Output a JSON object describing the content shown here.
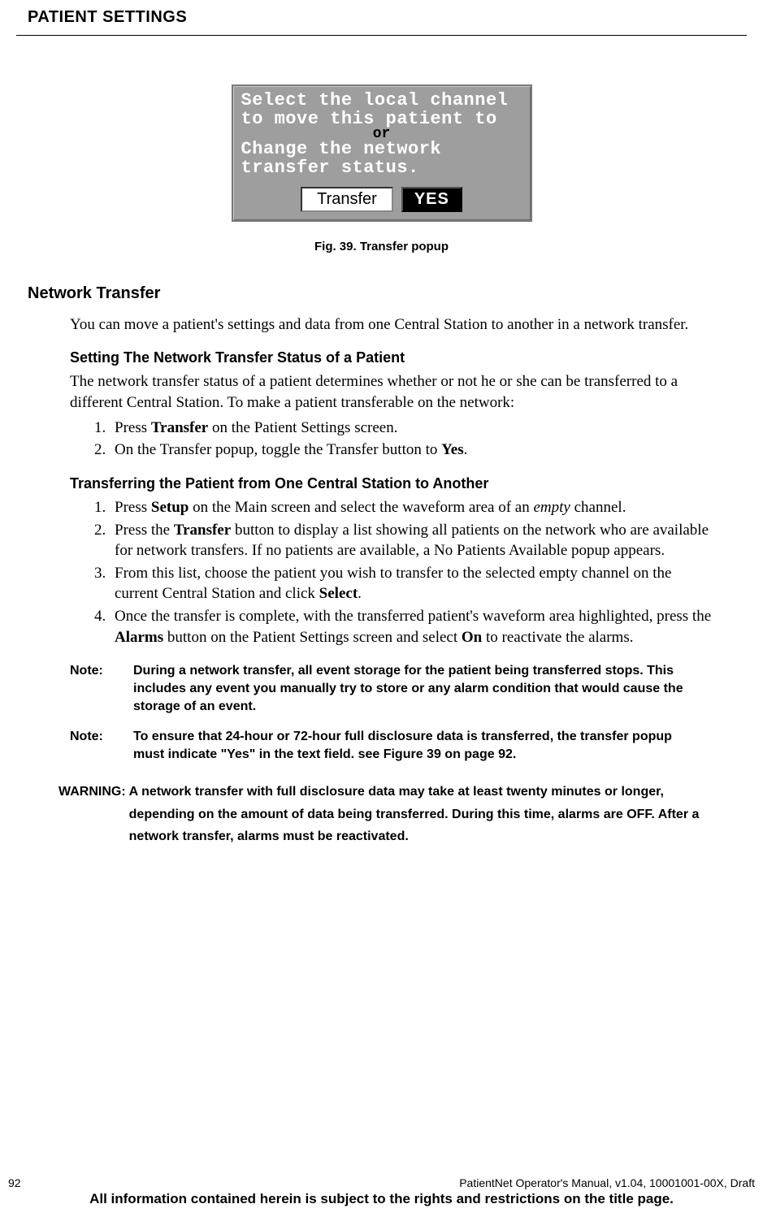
{
  "header": {
    "title": "PATIENT SETTINGS"
  },
  "figure": {
    "popup_line1": "Select the local channel",
    "popup_line2": "to move this patient to",
    "popup_or": "or",
    "popup_line3": "Change the network",
    "popup_line4": "transfer status.",
    "btn_transfer": "Transfer",
    "btn_yes": "YES",
    "caption": "Fig. 39. Transfer popup"
  },
  "section": {
    "h2": "Network Transfer",
    "intro": "You can move a patient's settings and data from one Central Station to another in a network transfer.",
    "sub1": {
      "title": "Setting The Network Transfer Status of a Patient",
      "para": "The network transfer status of a patient determines whether or not he or she can be transferred to a different Central Station. To make a patient transferable on the network:",
      "step1_a": "Press ",
      "step1_b": "Transfer",
      "step1_c": " on the Patient Settings screen.",
      "step2_a": "On the Transfer popup, toggle the Transfer button to ",
      "step2_b": "Yes",
      "step2_c": "."
    },
    "sub2": {
      "title": "Transferring the Patient from One Central Station to Another",
      "s1_a": "Press ",
      "s1_b": "Setup",
      "s1_c": " on the Main screen and select the waveform area of an ",
      "s1_d": "empty",
      "s1_e": " channel.",
      "s2_a": "Press the ",
      "s2_b": "Transfer",
      "s2_c": " button to display a list showing all patients on the network who are available for network transfers. If no patients are available, a No Patients Available popup appears.",
      "s3_a": "From this list, choose the patient you wish to transfer to the selected empty channel on the current Central Station and click ",
      "s3_b": "Select",
      "s3_c": ".",
      "s4_a": "Once the transfer is complete, with the transferred patient's waveform area highlighted, press the ",
      "s4_b": "Alarms",
      "s4_c": " button on the Patient Settings screen and select ",
      "s4_d": "On",
      "s4_e": " to reactivate the alarms."
    },
    "note1_label": "Note:",
    "note1_text": "During a network transfer, all event storage for the patient being transferred stops. This includes any event you manually try to store or any alarm condition that would cause the storage of an event.",
    "note2_label": "Note:",
    "note2_text": "To ensure that 24-hour or 72-hour full disclosure data is transferred, the transfer popup must indicate \"Yes\" in the text field. see Figure 39 on page 92.",
    "warning_label": "WARNING: ",
    "warning_text": "A network transfer with full disclosure data may take at least twenty minutes or longer, depending on the amount of data being transferred. During this time, alarms are OFF. After a network transfer, alarms must be reactivated."
  },
  "footer": {
    "page_no": "92",
    "doc_id": "PatientNet Operator's Manual, v1.04, 10001001-00X, Draft",
    "rights": "All information contained herein is subject to the rights and restrictions on the title page."
  }
}
